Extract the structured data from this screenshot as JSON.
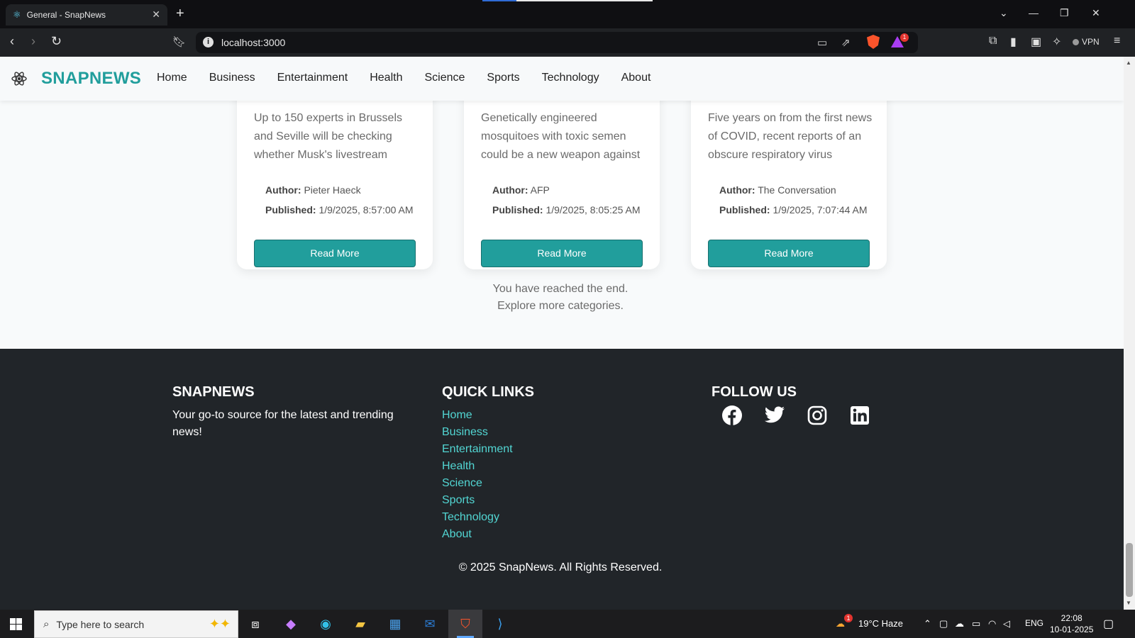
{
  "browser": {
    "tab_title": "General - SnapNews",
    "tab_close": "✕",
    "new_tab": "+",
    "url": "localhost:3000",
    "vpn_label": "VPN",
    "rewards_count": "1"
  },
  "site": {
    "brand": "SNAPNEWS",
    "nav": [
      "Home",
      "Business",
      "Entertainment",
      "Health",
      "Science",
      "Sports",
      "Technology",
      "About"
    ]
  },
  "cards": [
    {
      "description": "Up to 150 experts in Brussels and Seville will be checking whether Musk's livestream",
      "author_label": "Author:",
      "author": "Pieter Haeck",
      "published_label": "Published:",
      "published": "1/9/2025, 8:57:00 AM",
      "button": "Read More"
    },
    {
      "description": "Genetically engineered mosquitoes with toxic semen could be a new weapon against",
      "author_label": "Author:",
      "author": "AFP",
      "published_label": "Published:",
      "published": "1/9/2025, 8:05:25 AM",
      "button": "Read More"
    },
    {
      "description": "Five years on from the first news of COVID, recent reports of an obscure respiratory virus",
      "author_label": "Author:",
      "author": "The Conversation",
      "published_label": "Published:",
      "published": "1/9/2025, 7:07:44 AM",
      "button": "Read More"
    }
  ],
  "end_message": {
    "line1": "You have reached the end.",
    "line2": "Explore more categories."
  },
  "footer": {
    "brand_title": "SNAPNEWS",
    "tagline": "Your go-to source for the latest and trending news!",
    "links_title": "QUICK LINKS",
    "links": [
      "Home",
      "Business",
      "Entertainment",
      "Health",
      "Science",
      "Sports",
      "Technology",
      "About"
    ],
    "follow_title": "FOLLOW US",
    "socials": [
      "facebook-icon",
      "twitter-icon",
      "instagram-icon",
      "linkedin-icon"
    ],
    "copyright": "© 2025 SnapNews. All Rights Reserved."
  },
  "taskbar": {
    "search_placeholder": "Type here to search",
    "weather": "19°C  Haze",
    "weather_badge": "1",
    "language": "ENG",
    "time": "22:08",
    "date": "10-01-2025"
  },
  "colors": {
    "accent": "#219e9c",
    "footer_bg": "#212529",
    "link": "#52d6d3"
  }
}
